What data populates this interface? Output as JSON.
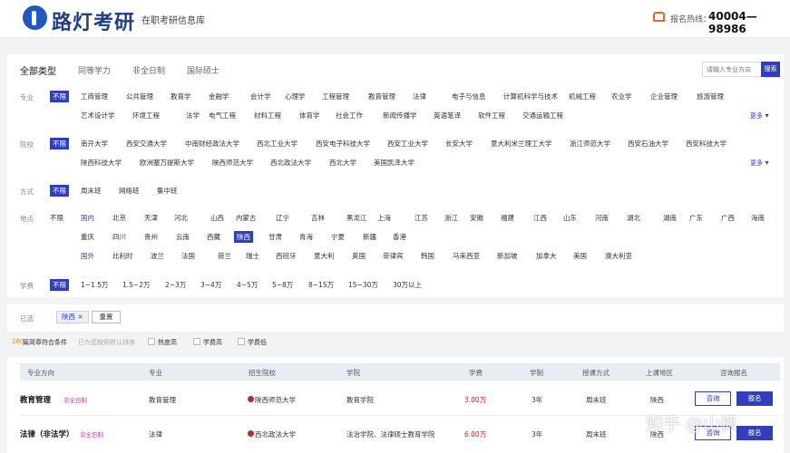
{
  "header": {
    "logo_text": "路灯考研",
    "subtitle": "在职考研信息库",
    "hotline_label": "报名热线：",
    "hotline_number": "40004—98986"
  },
  "tabs": [
    "全部类型",
    "同等学力",
    "非全日制",
    "国际硕士"
  ],
  "search": {
    "placeholder": "请输入专业方向",
    "button_label": "搜索"
  },
  "filters": {
    "major": {
      "label": "专业",
      "options": [
        "不限",
        "工商管理",
        "公共管理",
        "教育学",
        "金融学",
        "会计学",
        "心理学",
        "工程管理",
        "教育管理",
        "法律",
        "电子与信息",
        "计算机科学与技术",
        "机械工程",
        "农业学",
        "企业管理",
        "旅游管理",
        "艺术设计学",
        "环境工程",
        "法学",
        "电气工程",
        "材料工程",
        "体育学",
        "社会工作",
        "新闻传播学",
        "英语笔译",
        "软件工程",
        "交通运输工程"
      ],
      "more": "更多"
    },
    "school": {
      "label": "院校",
      "options": [
        "不限",
        "南开大学",
        "西安交通大学",
        "中南财经政法大学",
        "西北工业大学",
        "西安电子科技大学",
        "西安工业大学",
        "长安大学",
        "意大利米兰理工大学",
        "浙江师范大学",
        "西安石油大学",
        "西安科技大学",
        "陕西科技大学",
        "欧洲塞万提斯大学",
        "陕西师范大学",
        "西北政法大学",
        "西北大学",
        "美国凯泽大学"
      ],
      "more": "更多"
    },
    "mode": {
      "label": "方式",
      "options": [
        "不限",
        "周末班",
        "网络班",
        "集中班"
      ]
    },
    "location": {
      "label": "地点",
      "unlimited": "不限",
      "domestic_label": "国内",
      "domestic": [
        "北京",
        "天津",
        "河北",
        "山西",
        "内蒙古",
        "辽宁",
        "吉林",
        "黑龙江",
        "上海",
        "江苏",
        "浙江",
        "安徽",
        "福建",
        "江西",
        "山东",
        "河南",
        "湖北",
        "湖南",
        "广东",
        "广西",
        "海南",
        "重庆",
        "四川",
        "贵州",
        "云南",
        "西藏",
        "陕西",
        "甘肃",
        "青海",
        "宁夏",
        "新疆",
        "香港"
      ],
      "foreign_label": "国外",
      "foreign": [
        "比利时",
        "波兰",
        "法国",
        "荷兰",
        "瑞士",
        "西班牙",
        "意大利",
        "英国",
        "菲律宾",
        "韩国",
        "马来西亚",
        "新加坡",
        "加拿大",
        "美国",
        "澳大利亚"
      ]
    },
    "fee": {
      "label": "学费",
      "options": [
        "不限",
        "1~1.5万",
        "1.5~2万",
        "2~3万",
        "3~4万",
        "4~5万",
        "5~8万",
        "8~15万",
        "15~30万",
        "30万以上"
      ]
    }
  },
  "chosen": {
    "label": "已选",
    "chip": "陕西 ×",
    "reset": "重置"
  },
  "results": {
    "count": "280",
    "count_suffix": "篇简章符合条件",
    "sort_hint": "已为您按照默认排序",
    "sort_options": [
      "热度高",
      "学费高",
      "学费低"
    ]
  },
  "table": {
    "headers": [
      "专业方向",
      "专业",
      "招生院校",
      "学院",
      "学费",
      "学制",
      "授课方式",
      "上课地区",
      "咨询报名"
    ],
    "rows": [
      {
        "direction": "教育管理",
        "tag": "非全日制",
        "major": "教育管理",
        "school": "陕西师范大学",
        "college": "教育学院",
        "fee": "3.00万",
        "duration": "3年",
        "mode": "周末班",
        "region": "陕西",
        "consult": "咨询",
        "apply": "报名"
      },
      {
        "direction": "法律（非法学）",
        "tag": "非全日制",
        "major": "法律",
        "school": "西北政法大学",
        "college": "法治学院、法律硕士教育学院",
        "fee": "6.00万",
        "duration": "3年",
        "mode": "周末班",
        "region": "陕西",
        "consult": "咨询",
        "apply": "报名"
      }
    ]
  },
  "watermark": "知乎 @山枫"
}
